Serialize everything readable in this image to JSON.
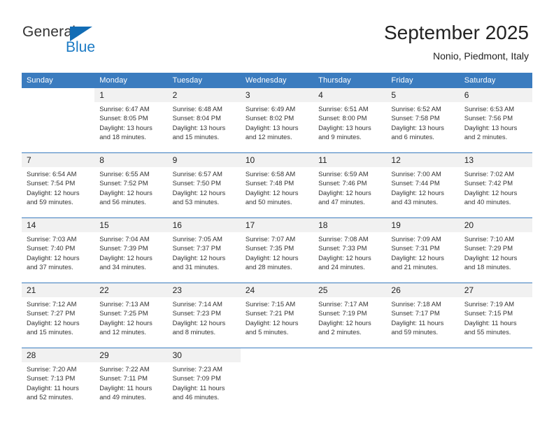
{
  "brand": {
    "name_part1": "General",
    "name_part2": "Blue",
    "triangle_color": "#126CB5",
    "blue_color": "#1B7AC4"
  },
  "header": {
    "month_title": "September 2025",
    "location": "Nonio, Piedmont, Italy"
  },
  "theme": {
    "header_blue": "#3B7CBF",
    "daynum_gray": "#F1F1F1"
  },
  "weekday_headers": [
    "Sunday",
    "Monday",
    "Tuesday",
    "Wednesday",
    "Thursday",
    "Friday",
    "Saturday"
  ],
  "weeks": [
    [
      {
        "day": "",
        "l1": "",
        "l2": "",
        "l3": "",
        "l4": ""
      },
      {
        "day": "1",
        "l1": "Sunrise: 6:47 AM",
        "l2": "Sunset: 8:05 PM",
        "l3": "Daylight: 13 hours",
        "l4": "and 18 minutes."
      },
      {
        "day": "2",
        "l1": "Sunrise: 6:48 AM",
        "l2": "Sunset: 8:04 PM",
        "l3": "Daylight: 13 hours",
        "l4": "and 15 minutes."
      },
      {
        "day": "3",
        "l1": "Sunrise: 6:49 AM",
        "l2": "Sunset: 8:02 PM",
        "l3": "Daylight: 13 hours",
        "l4": "and 12 minutes."
      },
      {
        "day": "4",
        "l1": "Sunrise: 6:51 AM",
        "l2": "Sunset: 8:00 PM",
        "l3": "Daylight: 13 hours",
        "l4": "and 9 minutes."
      },
      {
        "day": "5",
        "l1": "Sunrise: 6:52 AM",
        "l2": "Sunset: 7:58 PM",
        "l3": "Daylight: 13 hours",
        "l4": "and 6 minutes."
      },
      {
        "day": "6",
        "l1": "Sunrise: 6:53 AM",
        "l2": "Sunset: 7:56 PM",
        "l3": "Daylight: 13 hours",
        "l4": "and 2 minutes."
      }
    ],
    [
      {
        "day": "7",
        "l1": "Sunrise: 6:54 AM",
        "l2": "Sunset: 7:54 PM",
        "l3": "Daylight: 12 hours",
        "l4": "and 59 minutes."
      },
      {
        "day": "8",
        "l1": "Sunrise: 6:55 AM",
        "l2": "Sunset: 7:52 PM",
        "l3": "Daylight: 12 hours",
        "l4": "and 56 minutes."
      },
      {
        "day": "9",
        "l1": "Sunrise: 6:57 AM",
        "l2": "Sunset: 7:50 PM",
        "l3": "Daylight: 12 hours",
        "l4": "and 53 minutes."
      },
      {
        "day": "10",
        "l1": "Sunrise: 6:58 AM",
        "l2": "Sunset: 7:48 PM",
        "l3": "Daylight: 12 hours",
        "l4": "and 50 minutes."
      },
      {
        "day": "11",
        "l1": "Sunrise: 6:59 AM",
        "l2": "Sunset: 7:46 PM",
        "l3": "Daylight: 12 hours",
        "l4": "and 47 minutes."
      },
      {
        "day": "12",
        "l1": "Sunrise: 7:00 AM",
        "l2": "Sunset: 7:44 PM",
        "l3": "Daylight: 12 hours",
        "l4": "and 43 minutes."
      },
      {
        "day": "13",
        "l1": "Sunrise: 7:02 AM",
        "l2": "Sunset: 7:42 PM",
        "l3": "Daylight: 12 hours",
        "l4": "and 40 minutes."
      }
    ],
    [
      {
        "day": "14",
        "l1": "Sunrise: 7:03 AM",
        "l2": "Sunset: 7:40 PM",
        "l3": "Daylight: 12 hours",
        "l4": "and 37 minutes."
      },
      {
        "day": "15",
        "l1": "Sunrise: 7:04 AM",
        "l2": "Sunset: 7:39 PM",
        "l3": "Daylight: 12 hours",
        "l4": "and 34 minutes."
      },
      {
        "day": "16",
        "l1": "Sunrise: 7:05 AM",
        "l2": "Sunset: 7:37 PM",
        "l3": "Daylight: 12 hours",
        "l4": "and 31 minutes."
      },
      {
        "day": "17",
        "l1": "Sunrise: 7:07 AM",
        "l2": "Sunset: 7:35 PM",
        "l3": "Daylight: 12 hours",
        "l4": "and 28 minutes."
      },
      {
        "day": "18",
        "l1": "Sunrise: 7:08 AM",
        "l2": "Sunset: 7:33 PM",
        "l3": "Daylight: 12 hours",
        "l4": "and 24 minutes."
      },
      {
        "day": "19",
        "l1": "Sunrise: 7:09 AM",
        "l2": "Sunset: 7:31 PM",
        "l3": "Daylight: 12 hours",
        "l4": "and 21 minutes."
      },
      {
        "day": "20",
        "l1": "Sunrise: 7:10 AM",
        "l2": "Sunset: 7:29 PM",
        "l3": "Daylight: 12 hours",
        "l4": "and 18 minutes."
      }
    ],
    [
      {
        "day": "21",
        "l1": "Sunrise: 7:12 AM",
        "l2": "Sunset: 7:27 PM",
        "l3": "Daylight: 12 hours",
        "l4": "and 15 minutes."
      },
      {
        "day": "22",
        "l1": "Sunrise: 7:13 AM",
        "l2": "Sunset: 7:25 PM",
        "l3": "Daylight: 12 hours",
        "l4": "and 12 minutes."
      },
      {
        "day": "23",
        "l1": "Sunrise: 7:14 AM",
        "l2": "Sunset: 7:23 PM",
        "l3": "Daylight: 12 hours",
        "l4": "and 8 minutes."
      },
      {
        "day": "24",
        "l1": "Sunrise: 7:15 AM",
        "l2": "Sunset: 7:21 PM",
        "l3": "Daylight: 12 hours",
        "l4": "and 5 minutes."
      },
      {
        "day": "25",
        "l1": "Sunrise: 7:17 AM",
        "l2": "Sunset: 7:19 PM",
        "l3": "Daylight: 12 hours",
        "l4": "and 2 minutes."
      },
      {
        "day": "26",
        "l1": "Sunrise: 7:18 AM",
        "l2": "Sunset: 7:17 PM",
        "l3": "Daylight: 11 hours",
        "l4": "and 59 minutes."
      },
      {
        "day": "27",
        "l1": "Sunrise: 7:19 AM",
        "l2": "Sunset: 7:15 PM",
        "l3": "Daylight: 11 hours",
        "l4": "and 55 minutes."
      }
    ],
    [
      {
        "day": "28",
        "l1": "Sunrise: 7:20 AM",
        "l2": "Sunset: 7:13 PM",
        "l3": "Daylight: 11 hours",
        "l4": "and 52 minutes."
      },
      {
        "day": "29",
        "l1": "Sunrise: 7:22 AM",
        "l2": "Sunset: 7:11 PM",
        "l3": "Daylight: 11 hours",
        "l4": "and 49 minutes."
      },
      {
        "day": "30",
        "l1": "Sunrise: 7:23 AM",
        "l2": "Sunset: 7:09 PM",
        "l3": "Daylight: 11 hours",
        "l4": "and 46 minutes."
      },
      {
        "day": "",
        "l1": "",
        "l2": "",
        "l3": "",
        "l4": ""
      },
      {
        "day": "",
        "l1": "",
        "l2": "",
        "l3": "",
        "l4": ""
      },
      {
        "day": "",
        "l1": "",
        "l2": "",
        "l3": "",
        "l4": ""
      },
      {
        "day": "",
        "l1": "",
        "l2": "",
        "l3": "",
        "l4": ""
      }
    ]
  ]
}
